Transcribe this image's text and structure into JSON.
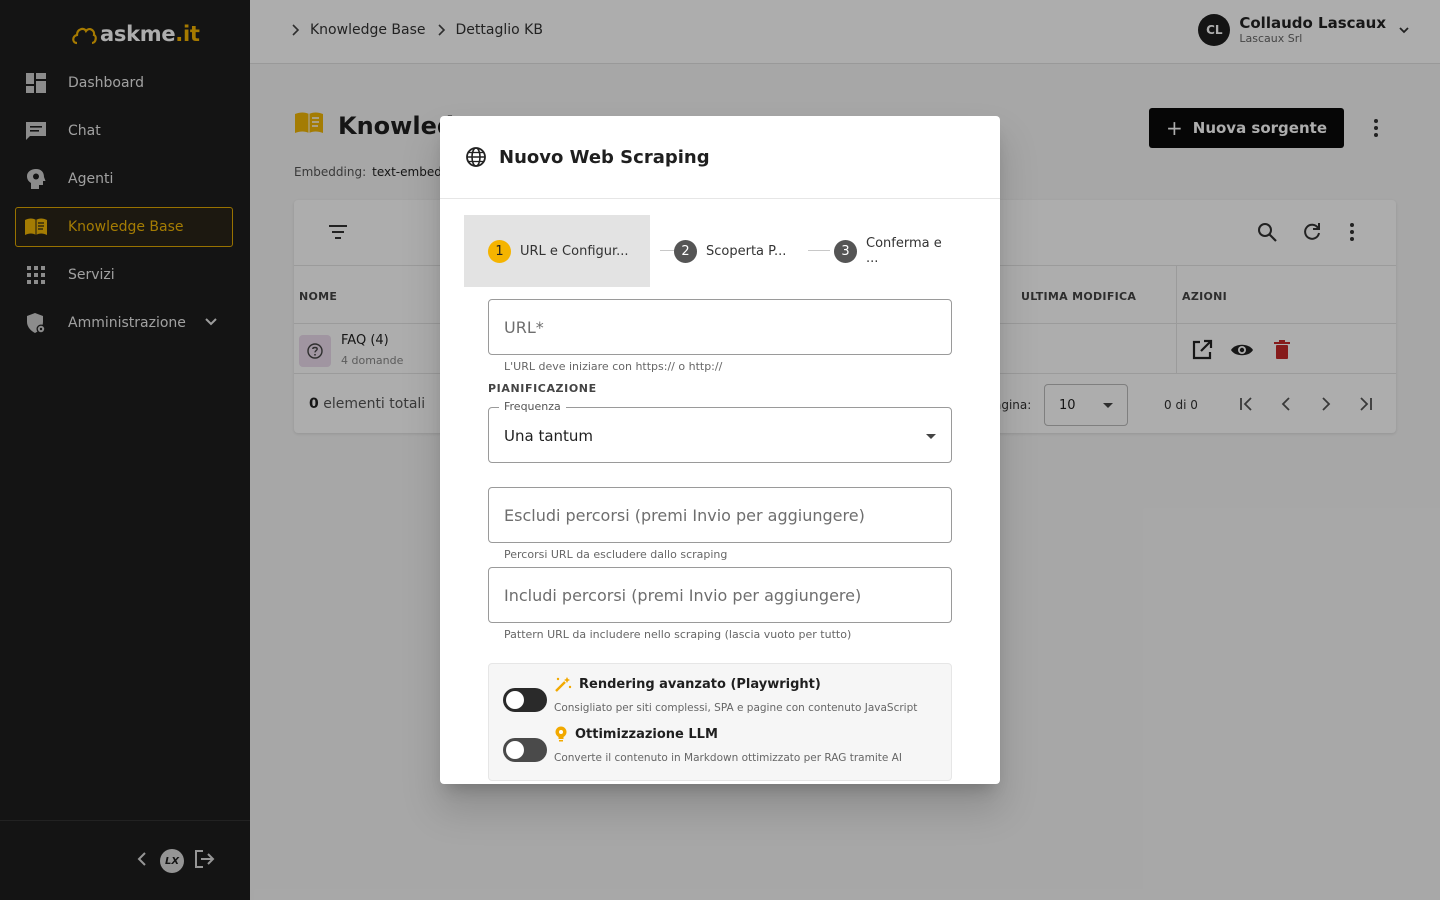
{
  "app": {
    "logo_text": "askme",
    "logo_tld": ".it"
  },
  "sidebar": {
    "items": [
      {
        "label": "Dashboard",
        "icon": "dashboard-icon"
      },
      {
        "label": "Chat",
        "icon": "chat-icon"
      },
      {
        "label": "Agenti",
        "icon": "agent-head-icon"
      },
      {
        "label": "Knowledge Base",
        "icon": "book-icon",
        "active": true
      },
      {
        "label": "Servizi",
        "icon": "grid-icon"
      },
      {
        "label": "Amministrazione",
        "icon": "admin-shield-icon",
        "expandable": true
      }
    ],
    "footer_badge": "LX"
  },
  "header": {
    "breadcrumb": [
      "Knowledge Base",
      "Dettaglio KB"
    ],
    "user": {
      "initials": "CL",
      "name": "Collaudo Lascaux",
      "org": "Lascaux Srl"
    }
  },
  "page": {
    "title": "Knowledg",
    "embedding_label": "Embedding:",
    "embedding_value": "text-embed",
    "new_source_button": "Nuova sorgente"
  },
  "table": {
    "columns": [
      "NOME",
      "ULTIMA MODIFICA",
      "AZIONI"
    ],
    "rows": [
      {
        "name": "FAQ (4)",
        "sub": "4 domande"
      }
    ],
    "total_count": "0",
    "total_label": "elementi totali",
    "rows_per_page_label": "agina:",
    "rows_per_page": "10",
    "range": "0 di 0"
  },
  "dialog": {
    "title": "Nuovo Web Scraping",
    "steps": [
      {
        "num": "1",
        "label": "URL e Configur..."
      },
      {
        "num": "2",
        "label": "Scoperta P..."
      },
      {
        "num": "3",
        "label": "Conferma e ..."
      }
    ],
    "url_placeholder": "URL*",
    "url_hint": "L'URL deve iniziare con https:// o http://",
    "scheduling_label": "PIANIFICAZIONE",
    "frequency_label": "Frequenza",
    "frequency_value": "Una tantum",
    "exclude_placeholder": "Escludi percorsi (premi Invio per aggiungere)",
    "exclude_hint": "Percorsi URL da escludere dallo scraping",
    "include_placeholder": "Includi percorsi (premi Invio per aggiungere)",
    "include_hint": "Pattern URL da includere nello scraping (lascia vuoto per tutto)",
    "options": [
      {
        "title": "Rendering avanzato (Playwright)",
        "desc": "Consigliato per siti complessi, SPA e pagine con contenuto JavaScript",
        "enabled": false
      },
      {
        "title": "Ottimizzazione LLM",
        "desc": "Converte il contenuto in Markdown ottimizzato per RAG tramite AI",
        "enabled": false
      }
    ]
  },
  "colors": {
    "accent": "#f5b400",
    "danger": "#c62828",
    "sidebar_bg": "#1e1e1e"
  }
}
